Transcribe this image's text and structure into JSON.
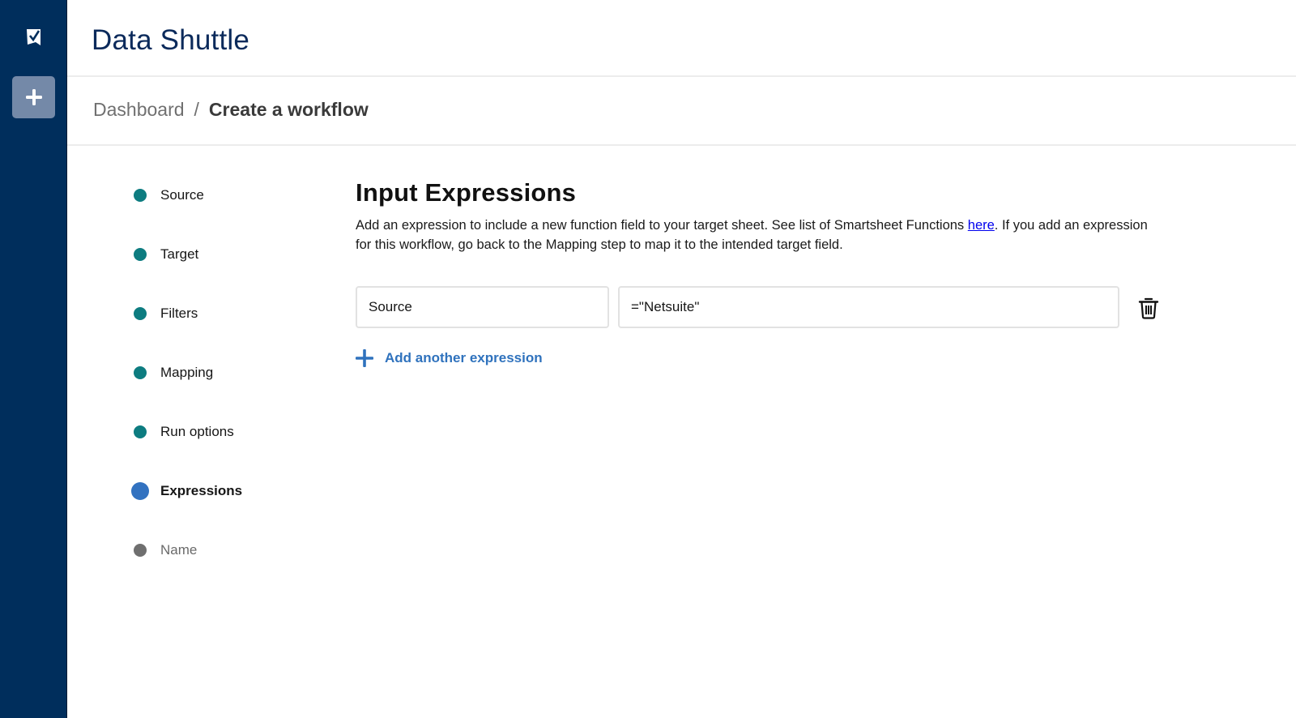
{
  "app": {
    "title": "Data Shuttle",
    "logo_icon": "smartsheet-check-logo-icon",
    "new_button_icon": "plus-icon"
  },
  "breadcrumb": {
    "items": [
      {
        "label": "Dashboard",
        "current": false
      },
      {
        "label": "Create a workflow",
        "current": true
      }
    ],
    "separator": "/"
  },
  "steps": [
    {
      "label": "Source",
      "state": "complete"
    },
    {
      "label": "Target",
      "state": "complete"
    },
    {
      "label": "Filters",
      "state": "complete"
    },
    {
      "label": "Mapping",
      "state": "complete"
    },
    {
      "label": "Run options",
      "state": "complete"
    },
    {
      "label": "Expressions",
      "state": "active"
    },
    {
      "label": "Name",
      "state": "pending"
    }
  ],
  "main": {
    "title": "Input Expressions",
    "description_before_link": "Add an expression to include a new function field to your target sheet. See list of Smartsheet Functions ",
    "link_text": "here",
    "description_after_link": ". If you add an expression for this workflow, go back to the Mapping step to map it to the intended target field.",
    "expressions": [
      {
        "name": "Source",
        "expression": "=\"Netsuite\"",
        "delete_icon": "trash-icon"
      }
    ],
    "add_label": "Add another expression"
  },
  "colors": {
    "sidebar": "#002e5c",
    "step_complete": "#0d7c80",
    "step_active": "#3272c0",
    "step_pending": "#6f6f6f",
    "accent_link": "#2f72bd",
    "title": "#0b2a5b"
  }
}
